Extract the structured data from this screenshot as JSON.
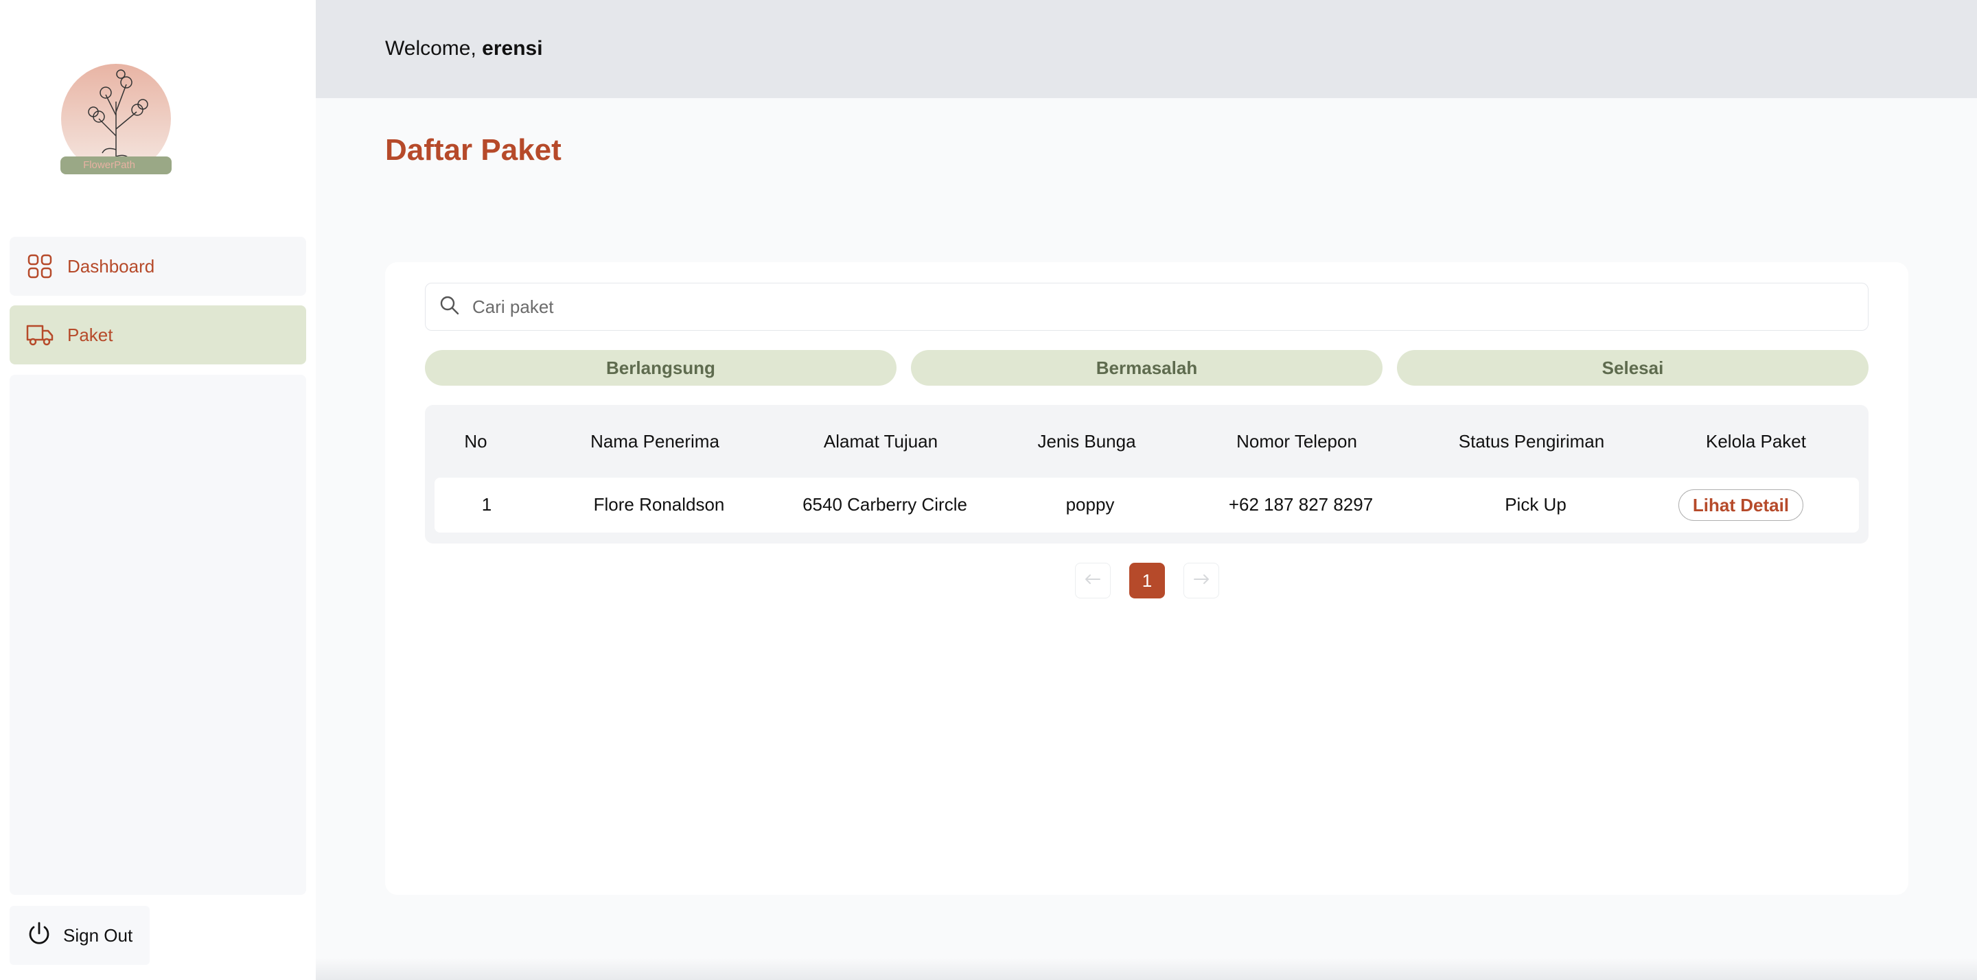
{
  "logo": {
    "text": "FlowerPath"
  },
  "sidebar": {
    "items": [
      {
        "label": "Dashboard",
        "icon": "dashboard-grid-icon"
      },
      {
        "label": "Paket",
        "icon": "truck-icon"
      }
    ],
    "signout_label": "Sign Out"
  },
  "header": {
    "welcome_prefix": "Welcome, ",
    "username": "erensi"
  },
  "page": {
    "title": "Daftar Paket"
  },
  "search": {
    "placeholder": "Cari paket",
    "value": ""
  },
  "filters": [
    "Berlangsung",
    "Bermasalah",
    "Selesai"
  ],
  "table": {
    "columns": [
      "No",
      "Nama Penerima",
      "Alamat Tujuan",
      "Jenis Bunga",
      "Nomor Telepon",
      "Status Pengiriman",
      "Kelola Paket"
    ],
    "rows": [
      {
        "no": "1",
        "nama": "Flore Ronaldson",
        "alamat": "6540 Carberry Circle",
        "bunga": "poppy",
        "telepon": "+62 187 827 8297",
        "status": "Pick Up",
        "action": "Lihat Detail"
      }
    ]
  },
  "pagination": {
    "current": "1"
  },
  "colors": {
    "accent": "#b64a2a",
    "filter_bg": "#e0e7d2",
    "header_bg": "#e5e7eb"
  }
}
